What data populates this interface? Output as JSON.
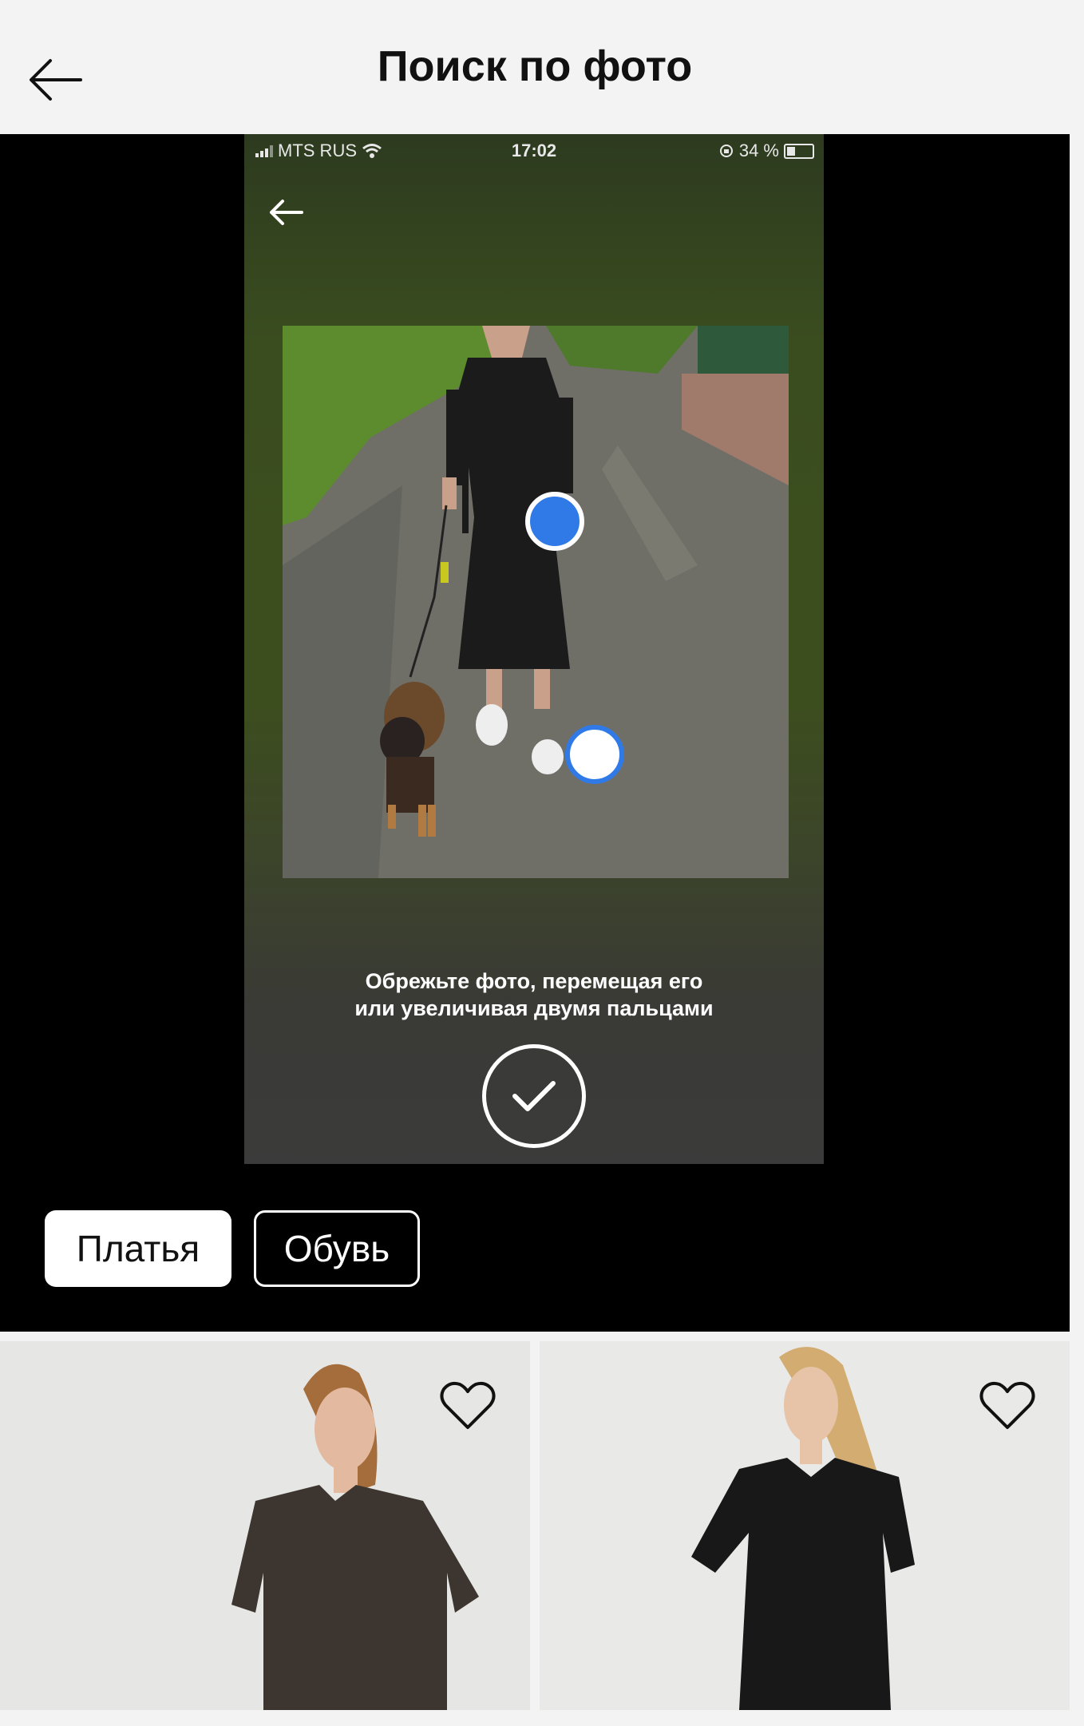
{
  "header": {
    "title": "Поиск по фото"
  },
  "phone_status": {
    "carrier": "MTS RUS",
    "time": "17:02",
    "battery": "34 %"
  },
  "crop": {
    "instruction_line1": "Обрежьте фото, перемещая его",
    "instruction_line2": "или увеличивая двумя пальцами"
  },
  "categories": [
    {
      "label": "Платья",
      "selected": true
    },
    {
      "label": "Обувь",
      "selected": false
    }
  ],
  "colors": {
    "accent": "#2f7ae6",
    "dark_bg": "#000000",
    "page_bg": "#f3f3f3"
  }
}
